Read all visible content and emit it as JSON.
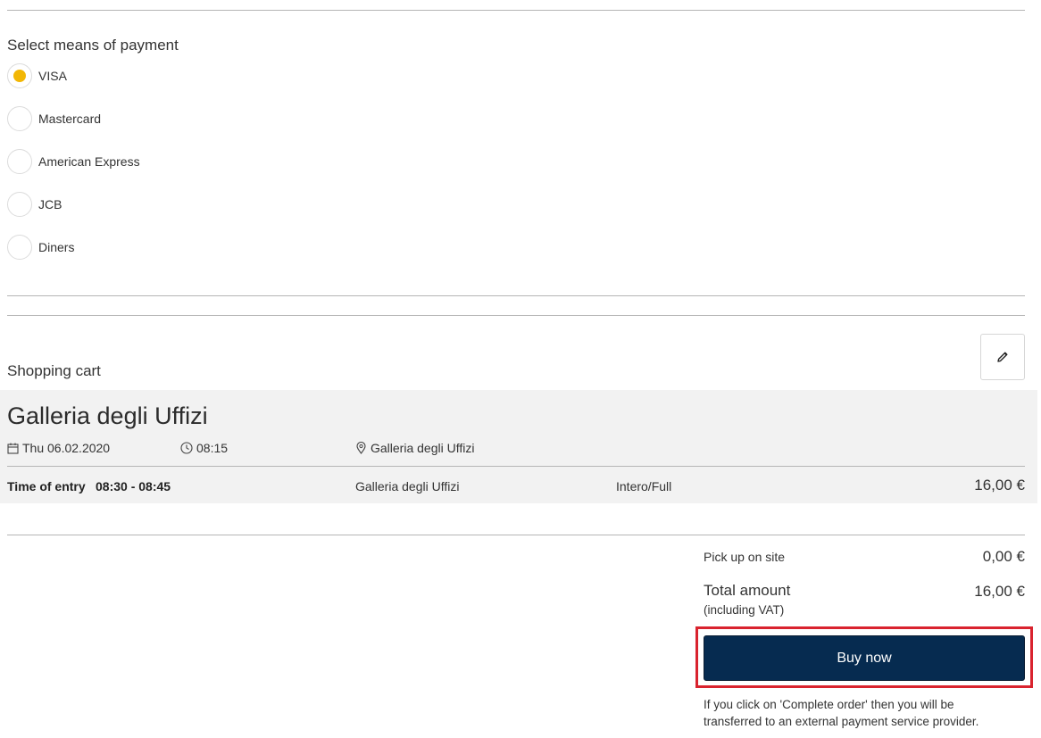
{
  "payment": {
    "title": "Select means of payment",
    "options": [
      {
        "label": "VISA",
        "selected": true
      },
      {
        "label": "Mastercard",
        "selected": false
      },
      {
        "label": "American Express",
        "selected": false
      },
      {
        "label": "JCB",
        "selected": false
      },
      {
        "label": "Diners",
        "selected": false
      }
    ],
    "accent_color": "#f2b705"
  },
  "cart": {
    "title": "Shopping cart",
    "edit_icon": "pencil-icon",
    "event": {
      "name": "Galleria degli Uffizi",
      "date": "Thu 06.02.2020",
      "time": "08:15",
      "location": "Galleria degli Uffizi"
    },
    "item": {
      "entry_label": "Time of entry",
      "entry_time": "08:30 - 08:45",
      "venue": "Galleria degli Uffizi",
      "ticket_type": "Intero/Full",
      "price": "16,00 €"
    }
  },
  "summary": {
    "pickup_label": "Pick up on site",
    "pickup_price": "0,00 €",
    "total_label": "Total amount",
    "vat_note": "(including VAT)",
    "total_price": "16,00 €"
  },
  "buy": {
    "button_label": "Buy now",
    "button_color": "#062b50",
    "highlight_color": "#d9232e",
    "note": "If you click on 'Complete order' then you will be transferred to an external payment service provider."
  }
}
